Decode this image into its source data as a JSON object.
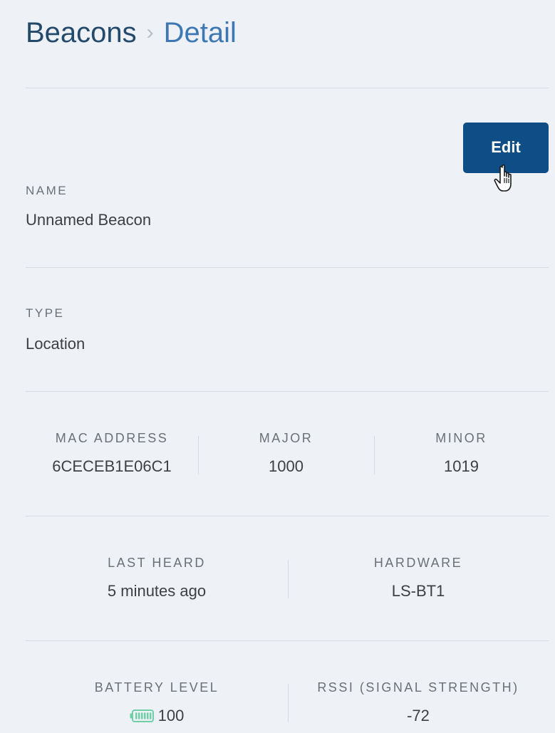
{
  "breadcrumb": {
    "root": "Beacons",
    "separator": "›",
    "current": "Detail"
  },
  "actions": {
    "edit_label": "Edit"
  },
  "fields": {
    "name_label": "NAME",
    "name_value": "Unnamed Beacon",
    "type_label": "TYPE",
    "type_value": "Location"
  },
  "identifiers": {
    "mac_label": "MAC ADDRESS",
    "mac_value": "6CECEB1E06C1",
    "major_label": "MAJOR",
    "major_value": "1000",
    "minor_label": "MINOR",
    "minor_value": "1019"
  },
  "status": {
    "last_heard_label": "LAST HEARD",
    "last_heard_value": "5 minutes ago",
    "hardware_label": "HARDWARE",
    "hardware_value": "LS-BT1"
  },
  "signal": {
    "battery_label": "BATTERY LEVEL",
    "battery_value": "100",
    "rssi_label": "RSSI (SIGNAL STRENGTH)",
    "rssi_value": "-72"
  },
  "colors": {
    "accent": "#0e4d86",
    "breadcrumb_root": "#23496b",
    "breadcrumb_current": "#3d78b4",
    "battery": "#6fd0a8",
    "background": "#eef1f5"
  },
  "icons": {
    "cursor": "hand-pointer-icon",
    "battery": "battery-full-icon"
  }
}
